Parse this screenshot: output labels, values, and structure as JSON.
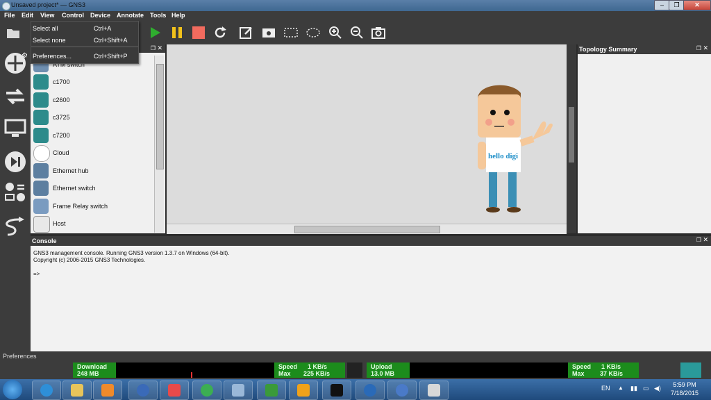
{
  "window": {
    "title": "Unsaved project* — GNS3"
  },
  "menubar": {
    "items": [
      "File",
      "Edit",
      "View",
      "Control",
      "Device",
      "Annotate",
      "Tools",
      "Help"
    ]
  },
  "edit_menu": {
    "items": [
      {
        "label": "Select all",
        "shortcut": "Ctrl+A"
      },
      {
        "label": "Select none",
        "shortcut": "Ctrl+Shift+A"
      },
      {
        "label": "Preferences...",
        "shortcut": "Ctrl+Shift+P"
      }
    ]
  },
  "devices": {
    "items": [
      "ATM switch",
      "c1700",
      "c2600",
      "c3725",
      "c7200",
      "Cloud",
      "Ethernet hub",
      "Ethernet switch",
      "Frame Relay switch",
      "Host"
    ]
  },
  "canvas": {
    "mascot_text": "hello digi"
  },
  "topology": {
    "title": "Topology Summary"
  },
  "console": {
    "title": "Console",
    "lines": [
      "GNS3 management console. Running GNS3 version 1.3.7 on Windows (64-bit).",
      "Copyright (c) 2006-2015 GNS3 Technologies.",
      "=>"
    ]
  },
  "status": {
    "text": "Preferences"
  },
  "netmeter": {
    "download": {
      "label": "Download",
      "total": "248 MB",
      "speed_label": "Speed",
      "speed": "1 KB/s",
      "max_label": "Max",
      "max": "225 KB/s"
    },
    "upload": {
      "label": "Upload",
      "total": "13.0 MB",
      "speed_label": "Speed",
      "speed": "1 KB/s",
      "max_label": "Max",
      "max": "37 KB/s"
    }
  },
  "taskbar": {
    "lang": "EN",
    "time": "5:59 PM",
    "date": "7/18/2015"
  },
  "colors": {
    "accent_green": "#2fae2f",
    "pause_yellow": "#f2c21b",
    "stop_red": "#f26b5e",
    "device_teal": "#2d8b8b"
  }
}
